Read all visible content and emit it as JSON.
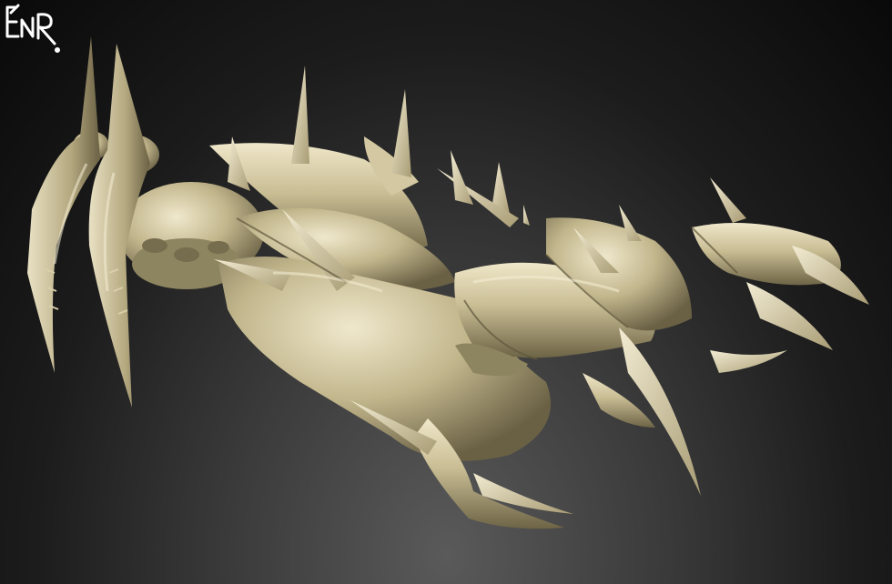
{
  "scene": {
    "subject_icon": "spiked-creature-sculpt-icon",
    "colors": {
      "background_center": "#5a5a5a",
      "background_edge": "#090909",
      "material_light": "#e8dfbf",
      "material_mid": "#bfb38a",
      "material_dark": "#6d6446",
      "signature": "#ffffff"
    }
  },
  "signature": {
    "text": "EnR",
    "icon": "artist-signature-icon"
  }
}
